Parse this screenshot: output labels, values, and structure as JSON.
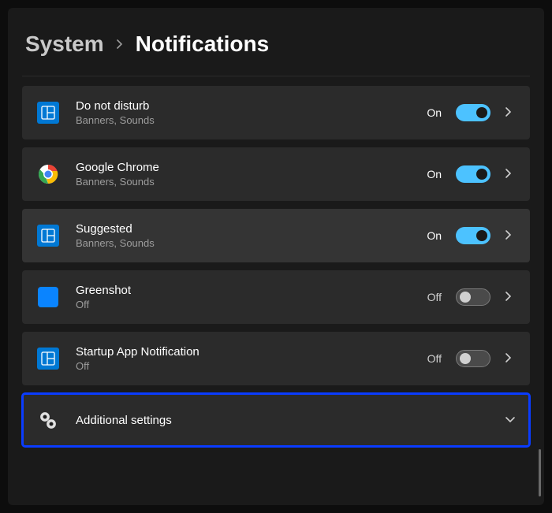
{
  "breadcrumb": {
    "parent": "System",
    "page": "Notifications"
  },
  "rows": [
    {
      "icon": "window-tile-icon",
      "title": "Do not disturb",
      "sub": "Banners, Sounds",
      "state_label": "On",
      "toggle_on": true,
      "nav": "chevron-right"
    },
    {
      "icon": "chrome-icon",
      "title": "Google Chrome",
      "sub": "Banners, Sounds",
      "state_label": "On",
      "toggle_on": true,
      "nav": "chevron-right"
    },
    {
      "icon": "window-tile-icon",
      "title": "Suggested",
      "sub": "Banners, Sounds",
      "state_label": "On",
      "toggle_on": true,
      "nav": "chevron-right",
      "hover": true
    },
    {
      "icon": "blue-square-icon",
      "title": "Greenshot",
      "sub": "Off",
      "state_label": "Off",
      "toggle_on": false,
      "nav": "chevron-right"
    },
    {
      "icon": "window-tile-icon",
      "title": "Startup App Notification",
      "sub": "Off",
      "state_label": "Off",
      "toggle_on": false,
      "nav": "chevron-right"
    }
  ],
  "additional": {
    "label": "Additional settings"
  }
}
